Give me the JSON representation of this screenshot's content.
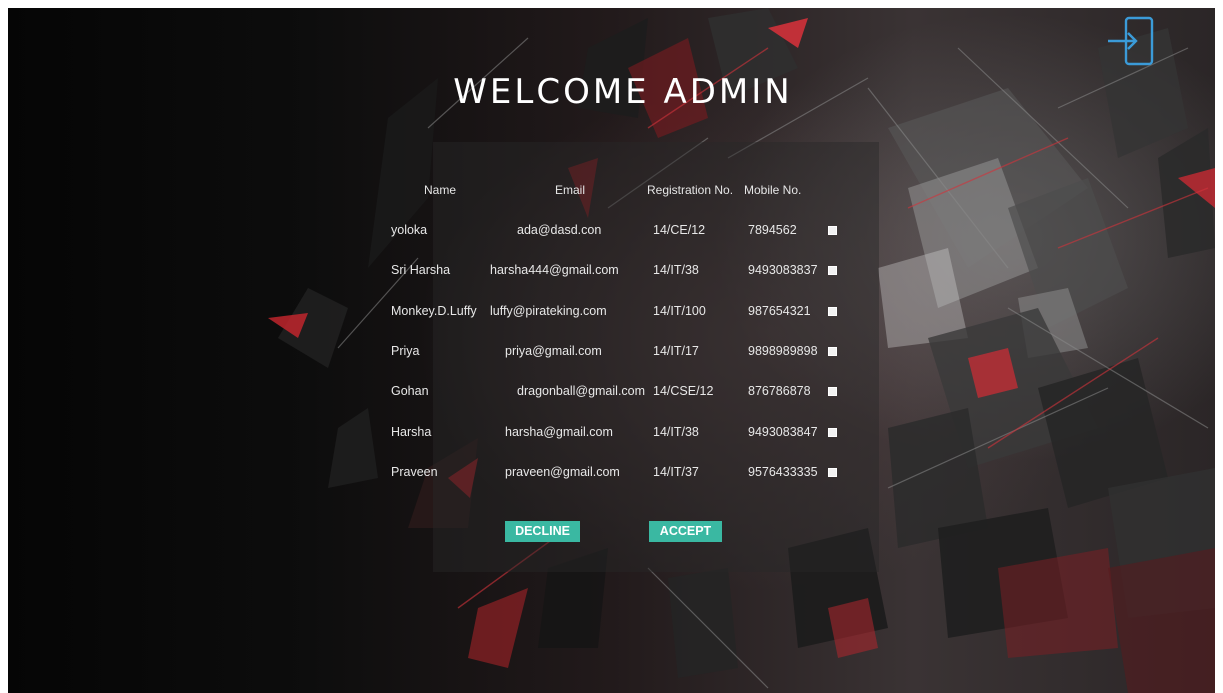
{
  "header": {
    "title": "WELCOME  ADMIN"
  },
  "icons": {
    "logout": "logout-icon",
    "accent_color": "#3b9bd8"
  },
  "table": {
    "columns": [
      "Name",
      "Email",
      "Registration No.",
      "Mobile No."
    ],
    "rows": [
      {
        "name": "yoloka",
        "email": "ada@dasd.con",
        "reg": "14/CE/12",
        "mobile": "7894562"
      },
      {
        "name": "Sri Harsha",
        "email": "harsha444@gmail.com",
        "reg": "14/IT/38",
        "mobile": "9493083837"
      },
      {
        "name": "Monkey.D.Luffy",
        "email": "luffy@pirateking.com",
        "reg": "14/IT/100",
        "mobile": "987654321"
      },
      {
        "name": "Priya",
        "email": "priya@gmail.com",
        "reg": "14/IT/17",
        "mobile": "9898989898"
      },
      {
        "name": "Gohan",
        "email": "dragonball@gmail.com",
        "reg": "14/CSE/12",
        "mobile": "876786878"
      },
      {
        "name": "Harsha",
        "email": "harsha@gmail.com",
        "reg": "14/IT/38",
        "mobile": "9493083847"
      },
      {
        "name": "Praveen",
        "email": "praveen@gmail.com",
        "reg": "14/IT/37",
        "mobile": "9576433335"
      }
    ]
  },
  "actions": {
    "decline_label": "DECLINE",
    "accept_label": "ACCEPT",
    "button_color": "#3ab8a2"
  }
}
